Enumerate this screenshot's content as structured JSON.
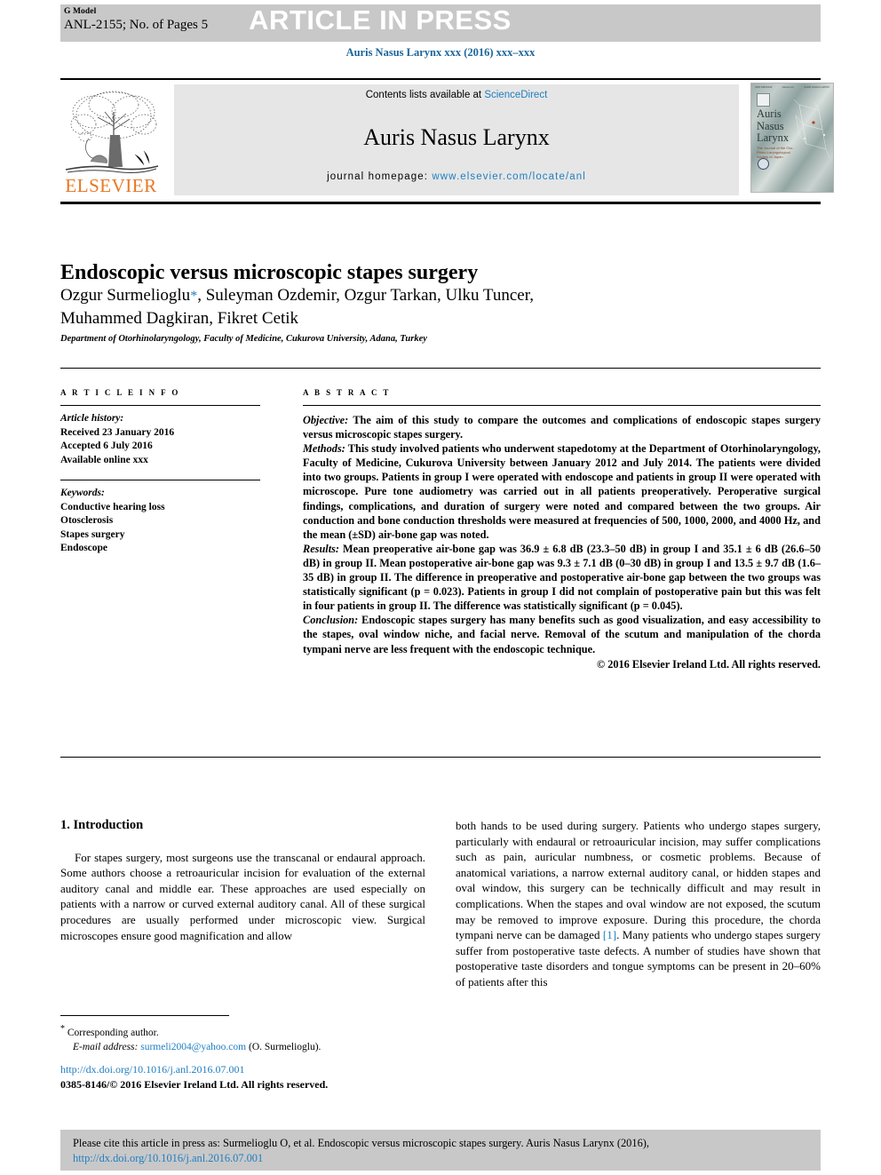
{
  "banner": {
    "g_model": "G Model",
    "article_code": "ANL-2155; No. of Pages 5",
    "status": "ARTICLE IN PRESS"
  },
  "journal_ref": "Auris Nasus Larynx xxx (2016) xxx–xxx",
  "masthead": {
    "contents_prefix": "Contents lists available at ",
    "sciencedirect": "ScienceDirect",
    "journal_name": "Auris Nasus Larynx",
    "homepage_prefix": "journal homepage: ",
    "homepage_url": "www.elsevier.com/locate/anl",
    "publisher_wordmark": "ELSEVIER",
    "cover": {
      "title_line1": "Auris",
      "title_line2": "Nasus",
      "title_line3": "Larynx",
      "subtitle": "The Journal of the Oto-Rhino-Laryngological Society of Japan",
      "head_left": "ISSN 0385-8146",
      "head_mid": "Volume xxx",
      "head_right": "AURIS NASUS LARYNX"
    }
  },
  "article": {
    "title": "Endoscopic versus microscopic stapes surgery",
    "authors_line1": "Ozgur Surmelioglu",
    "authors_star": "*",
    "authors_line1_rest": ", Suleyman Ozdemir, Ozgur Tarkan, Ulku Tuncer,",
    "authors_line2": "Muhammed Dagkiran, Fikret Cetik",
    "affiliation": "Department of Otorhinolaryngology, Faculty of Medicine, Cukurova University, Adana, Turkey"
  },
  "article_info": {
    "heading": "A R T I C L E   I N F O",
    "history_label": "Article history:",
    "received": "Received 23 January 2016",
    "accepted": "Accepted 6 July 2016",
    "available": "Available online xxx",
    "keywords_label": "Keywords:",
    "keywords": [
      "Conductive hearing loss",
      "Otosclerosis",
      "Stapes surgery",
      "Endoscope"
    ]
  },
  "abstract": {
    "heading": "A B S T R A C T",
    "objective_label": "Objective:",
    "objective_text": " The aim of this study to compare the outcomes and complications of endoscopic stapes surgery versus microscopic stapes surgery.",
    "methods_label": "Methods:",
    "methods_text": " This study involved patients who underwent stapedotomy at the Department of Otorhinolaryngology, Faculty of Medicine, Cukurova University between January 2012 and July 2014. The patients were divided into two groups. Patients in group I were operated with endoscope and patients in group II were operated with microscope. Pure tone audiometry was carried out in all patients preoperatively. Peroperative surgical findings, complications, and duration of surgery were noted and compared between the two groups. Air conduction and bone conduction thresholds were measured at frequencies of 500, 1000, 2000, and 4000 Hz, and the mean (±SD) air-bone gap was noted.",
    "results_label": "Results:",
    "results_text": " Mean preoperative air-bone gap was 36.9 ± 6.8 dB (23.3–50 dB) in group I and 35.1 ± 6 dB (26.6–50 dB) in group II. Mean postoperative air-bone gap was 9.3 ± 7.1 dB (0–30 dB) in group I and 13.5 ± 9.7 dB (1.6–35 dB) in group II. The difference in preoperative and postoperative air-bone gap between the two groups was statistically significant (p = 0.023). Patients in group I did not complain of postoperative pain but this was felt in four patients in group II. The difference was statistically significant (p = 0.045).",
    "conclusion_label": "Conclusion:",
    "conclusion_text": " Endoscopic stapes surgery has many benefits such as good visualization, and easy accessibility to the stapes, oval window niche, and facial nerve. Removal of the scutum and manipulation of the chorda tympani nerve are less frequent with the endoscopic technique.",
    "copyright": "© 2016 Elsevier Ireland Ltd. All rights reserved."
  },
  "body": {
    "section_title": "1.  Introduction",
    "left_paragraph": "For stapes surgery, most surgeons use the transcanal or endaural approach. Some authors choose a retroauricular incision for evaluation of the external auditory canal and middle ear. These approaches are used especially on patients with a narrow or curved external auditory canal. All of these surgical procedures are usually performed under microscopic view. Surgical microscopes ensure good magnification and allow",
    "right_paragraph_part1": "both hands to be used during surgery. Patients who undergo stapes surgery, particularly with endaural or retroauricular incision, may suffer complications such as pain, auricular numbness, or cosmetic problems. Because of anatomical variations, a narrow external auditory canal, or hidden stapes and oval window, this surgery can be technically difficult and may result in complications. When the stapes and oval window are not exposed, the scutum may be removed to improve exposure. During this procedure, the chorda tympani nerve can be damaged ",
    "right_reference": "[1]",
    "right_paragraph_part2": ". Many patients who undergo stapes surgery suffer from postoperative taste defects. A number of studies have shown that postoperative taste disorders and tongue symptoms can be present in 20–60% of patients after this"
  },
  "footnotes": {
    "corresponding_star": "*",
    "corresponding_label": " Corresponding author.",
    "email_label": "E-mail address:",
    "email": "surmeli2004@yahoo.com",
    "email_suffix": " (O. Surmelioglu).",
    "doi_url": "http://dx.doi.org/10.1016/j.anl.2016.07.001",
    "issn_line": "0385-8146/© 2016 Elsevier Ireland Ltd. All rights reserved."
  },
  "cite_footer": {
    "text": "Please cite this article in press as: Surmelioglu O, et al. Endoscopic versus microscopic stapes surgery. Auris Nasus Larynx (2016), ",
    "link": "http://dx.doi.org/10.1016/j.anl.2016.07.001"
  },
  "colors": {
    "link_blue": "#1f7ec1",
    "ref_blue": "#19659b",
    "elsevier_orange": "#e87722",
    "banner_grey": "#c8c8c8",
    "masthead_grey": "#e6e6e6"
  }
}
